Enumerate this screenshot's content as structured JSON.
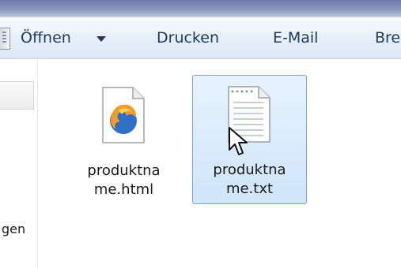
{
  "toolbar": {
    "open_label": "Öffnen",
    "print_label": "Drucken",
    "email_label": "E-Mail",
    "burn_label_partial": "Bre"
  },
  "navigation": {
    "label_partial": "gen"
  },
  "files": [
    {
      "name_line1": "produktna",
      "name_line2": "me.html",
      "icon": "firefox-html-file-icon",
      "selected": false
    },
    {
      "name_line1": "produktna",
      "name_line2": "me.txt",
      "icon": "text-file-icon",
      "selected": true
    }
  ],
  "colors": {
    "toolbar_text": "#1e395b",
    "selection_fill": "#cfe5fb",
    "selection_border": "#7da2ce"
  }
}
